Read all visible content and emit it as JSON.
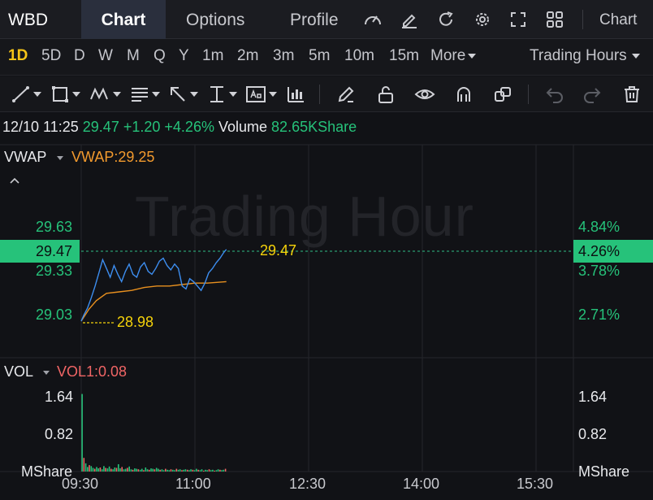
{
  "header": {
    "symbol": "WBD",
    "tabs": [
      {
        "label": "Chart",
        "active": true
      },
      {
        "label": "Options",
        "active": false
      },
      {
        "label": "Profile",
        "active": false
      }
    ],
    "icons": [
      "speedometer-icon",
      "edit-icon",
      "refresh-icon",
      "settings-gear-icon",
      "fullscreen-icon",
      "grid-layout-icon"
    ],
    "chart_menu_label": "Chart"
  },
  "periods": {
    "items": [
      "1D",
      "5D",
      "D",
      "W",
      "M",
      "Q",
      "Y",
      "1m",
      "2m",
      "3m",
      "5m",
      "10m",
      "15m"
    ],
    "active": "1D",
    "more_label": "More",
    "session_label": "Trading Hours"
  },
  "toolbar": {
    "tools": [
      "trend-line-icon",
      "rectangle-icon",
      "pattern-icon",
      "fibonacci-icon",
      "arrow-icon",
      "measure-icon",
      "text-annotation-icon",
      "candle-pattern-icon",
      "pencil-icon",
      "unlock-icon",
      "eye-icon",
      "magnet-icon",
      "copy-icon",
      "undo-icon",
      "redo-icon",
      "trash-icon"
    ]
  },
  "quote": {
    "datetime": "12/10 11:25",
    "price": "29.47",
    "change": "+1.20",
    "change_pct": "+4.26%",
    "volume_label": "Volume",
    "volume_value": "82.65KShare"
  },
  "price_panel": {
    "indicator": "VWAP",
    "indicator_value_label": "VWAP:29.25",
    "watermark": "Trading Hour",
    "current_price_tag": "29.47",
    "current_pct_tag": "4.26%",
    "price_line_label": "29.47",
    "low_label": "28.98",
    "left_ticks": [
      "29.63",
      "29.33",
      "29.03"
    ],
    "right_ticks": [
      "4.84%",
      "3.78%",
      "2.71%"
    ]
  },
  "volume_panel": {
    "indicator": "VOL",
    "indicator_value_label": "VOL1:0.08",
    "left_ticks": [
      "1.64",
      "0.82",
      "MShare"
    ],
    "right_ticks": [
      "1.64",
      "0.82",
      "MShare"
    ]
  },
  "time_axis": [
    "09:30",
    "11:00",
    "12:30",
    "14:00",
    "15:30"
  ],
  "colors": {
    "up": "#26c27a",
    "down": "#f06565",
    "vwap": "#f29a2e",
    "price_line": "#3d8ef0",
    "highlight": "#f5d20a",
    "active_period": "#f5c518"
  },
  "chart_data": {
    "type": "line",
    "x_range": [
      "09:30",
      "16:00"
    ],
    "price_ylim": [
      28.92,
      29.7
    ],
    "price": [
      [
        "09:30",
        28.98
      ],
      [
        "09:32",
        29.02
      ],
      [
        "09:35",
        29.07
      ],
      [
        "09:38",
        29.14
      ],
      [
        "09:41",
        29.22
      ],
      [
        "09:44",
        29.31
      ],
      [
        "09:47",
        29.4
      ],
      [
        "09:50",
        29.34
      ],
      [
        "09:53",
        29.28
      ],
      [
        "09:56",
        29.36
      ],
      [
        "09:59",
        29.3
      ],
      [
        "10:02",
        29.25
      ],
      [
        "10:05",
        29.32
      ],
      [
        "10:08",
        29.37
      ],
      [
        "10:11",
        29.3
      ],
      [
        "10:14",
        29.28
      ],
      [
        "10:17",
        29.35
      ],
      [
        "10:20",
        29.38
      ],
      [
        "10:23",
        29.32
      ],
      [
        "10:26",
        29.3
      ],
      [
        "10:29",
        29.34
      ],
      [
        "10:32",
        29.39
      ],
      [
        "10:35",
        29.41
      ],
      [
        "10:38",
        29.36
      ],
      [
        "10:41",
        29.33
      ],
      [
        "10:44",
        29.37
      ],
      [
        "10:47",
        29.34
      ],
      [
        "10:50",
        29.22
      ],
      [
        "10:53",
        29.2
      ],
      [
        "10:56",
        29.27
      ],
      [
        "10:59",
        29.25
      ],
      [
        "11:02",
        29.22
      ],
      [
        "11:05",
        29.19
      ],
      [
        "11:08",
        29.24
      ],
      [
        "11:11",
        29.31
      ],
      [
        "11:14",
        29.34
      ],
      [
        "11:17",
        29.38
      ],
      [
        "11:20",
        29.41
      ],
      [
        "11:23",
        29.45
      ],
      [
        "11:25",
        29.47
      ]
    ],
    "vwap": [
      [
        "09:30",
        28.98
      ],
      [
        "09:36",
        29.06
      ],
      [
        "09:42",
        29.12
      ],
      [
        "09:50",
        29.17
      ],
      [
        "10:00",
        29.18
      ],
      [
        "10:10",
        29.19
      ],
      [
        "10:20",
        29.21
      ],
      [
        "10:30",
        29.22
      ],
      [
        "10:40",
        29.22
      ],
      [
        "10:50",
        29.23
      ],
      [
        "11:00",
        29.24
      ],
      [
        "11:10",
        29.24
      ],
      [
        "11:25",
        29.25
      ]
    ],
    "vol_ylim": [
      0,
      1.8
    ],
    "volume": [
      1.7,
      0.3,
      0.18,
      0.1,
      0.14,
      0.12,
      0.08,
      0.06,
      0.1,
      0.07,
      0.09,
      0.05,
      0.12,
      0.08,
      0.07,
      0.11,
      0.06,
      0.05,
      0.09,
      0.08,
      0.16,
      0.07,
      0.1,
      0.05,
      0.06,
      0.08,
      0.11,
      0.05,
      0.04,
      0.07,
      0.06,
      0.05,
      0.04,
      0.06,
      0.03,
      0.09,
      0.05,
      0.04,
      0.07,
      0.06,
      0.05,
      0.08,
      0.06,
      0.04,
      0.05,
      0.03,
      0.06,
      0.04,
      0.03,
      0.05,
      0.04,
      0.03,
      0.06,
      0.04,
      0.05,
      0.03,
      0.04,
      0.05,
      0.04,
      0.03,
      0.05,
      0.04,
      0.03,
      0.06,
      0.04,
      0.03,
      0.05,
      0.02,
      0.04,
      0.03,
      0.05,
      0.03,
      0.04,
      0.02,
      0.03,
      0.05,
      0.04,
      0.03,
      0.04,
      0.06
    ]
  }
}
